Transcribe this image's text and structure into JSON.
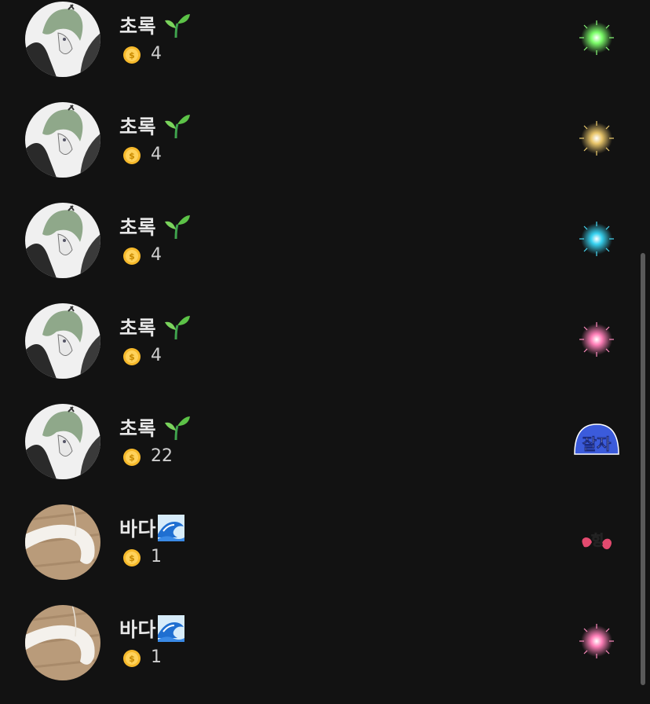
{
  "items": [
    {
      "name": "초록",
      "badge": "sprout-icon",
      "coins": "4",
      "avatar": "anime-avatar",
      "gift": "green-firework",
      "gift_color": "#7CFF6A"
    },
    {
      "name": "초록",
      "badge": "sprout-icon",
      "coins": "4",
      "avatar": "anime-avatar",
      "gift": "gold-firework",
      "gift_color": "#E8C56A"
    },
    {
      "name": "초록",
      "badge": "sprout-icon",
      "coins": "4",
      "avatar": "anime-avatar",
      "gift": "cyan-firework",
      "gift_color": "#37D2F0"
    },
    {
      "name": "초록",
      "badge": "sprout-icon",
      "coins": "4",
      "avatar": "anime-avatar",
      "gift": "pink-firework",
      "gift_color": "#FF7FB8"
    },
    {
      "name": "초록",
      "badge": "sprout-icon",
      "coins": "22",
      "avatar": "anime-avatar",
      "gift": "goodnight-sticker",
      "gift_text": "잘자",
      "gift_color": "#3B5BDB"
    },
    {
      "name": "바다",
      "badge": "wave-icon",
      "coins": "1",
      "avatar": "cat-tail-photo",
      "gift": "heart-sticker",
      "gift_text": "힝",
      "gift_color": "#E34A6F"
    },
    {
      "name": "바다",
      "badge": "wave-icon",
      "coins": "1",
      "avatar": "cat-tail-photo",
      "gift": "pink-firework",
      "gift_color": "#FF7FB8"
    }
  ],
  "colors": {
    "background": "#121212",
    "name_text": "#e6e6e6",
    "count_text": "#cfcfcf",
    "coin": "#F6B92B",
    "scrollbar": "#5a5a5a"
  }
}
